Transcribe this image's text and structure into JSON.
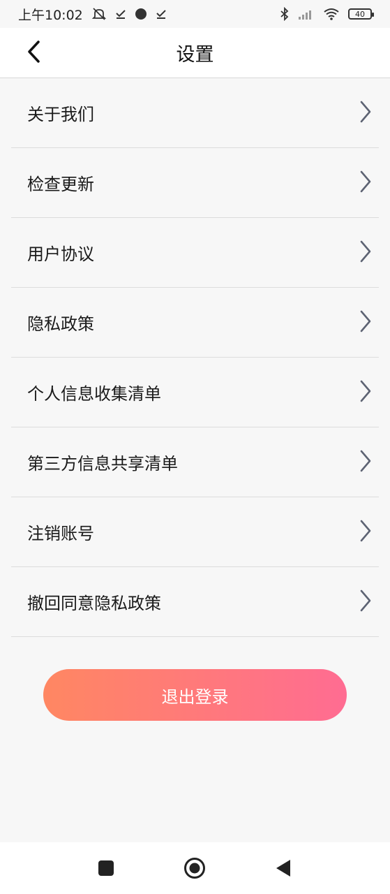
{
  "status_bar": {
    "time": "上午10:02",
    "battery": "40",
    "icons": [
      "mute-notification-icon",
      "check-icon",
      "dot-icon",
      "check-icon",
      "bluetooth-icon",
      "signal-icon",
      "wifi-icon",
      "battery-icon"
    ]
  },
  "header": {
    "title": "设置",
    "back_icon": "chevron-left-icon"
  },
  "settings_items": [
    {
      "label": "关于我们"
    },
    {
      "label": "检查更新"
    },
    {
      "label": "用户协议"
    },
    {
      "label": "隐私政策"
    },
    {
      "label": "个人信息收集清单"
    },
    {
      "label": "第三方信息共享清单"
    },
    {
      "label": "注销账号"
    },
    {
      "label": "撤回同意隐私政策"
    }
  ],
  "logout_button": {
    "label": "退出登录",
    "gradient_start": "#ff8762",
    "gradient_end": "#ff6c92"
  },
  "nav_bar": {
    "buttons": [
      "recents-square-icon",
      "home-circle-icon",
      "back-triangle-icon"
    ]
  }
}
